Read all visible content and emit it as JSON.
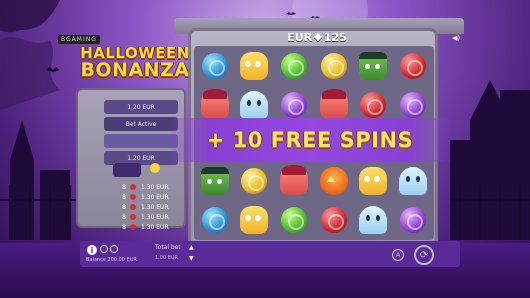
{
  "header": {
    "brand": "BGAMING",
    "balance_currency": "EUR",
    "balance_value": "125"
  },
  "game": {
    "title_line1": "HALLOWEEN",
    "title_line2": "BONANZA"
  },
  "side_panel": {
    "options": [
      "1.20 EUR",
      "Bet Active",
      "",
      "1.20 EUR"
    ],
    "paytable": [
      {
        "count": "8",
        "amount": "1.30 EUR"
      },
      {
        "count": "8",
        "amount": "1.30 EUR"
      },
      {
        "count": "8",
        "amount": "1.30 EUR"
      },
      {
        "count": "8",
        "amount": "1.30 EUR"
      },
      {
        "count": "8",
        "amount": "1.30 EUR"
      }
    ]
  },
  "reels": [
    [
      "blue",
      "mummy",
      "green",
      "yellow",
      "frank",
      "red"
    ],
    [
      "witch",
      "ghost",
      "purple",
      "witch",
      "red",
      "purple"
    ],
    [
      "",
      "",
      "",
      "",
      "",
      ""
    ],
    [
      "frank",
      "yellow",
      "witch",
      "pumpkin",
      "mummy",
      "ghost"
    ],
    [
      "blue",
      "mummy",
      "green",
      "red",
      "ghost",
      "purple"
    ]
  ],
  "banner": {
    "text": "+ 10 FREE SPINS"
  },
  "footer": {
    "info_icon": "i",
    "balance_label": "Balance 200.00 EUR",
    "total_bet_label": "Total bet",
    "total_bet_value": "1.00 EUR",
    "auto_label": "A",
    "spin_icon": "refresh-icon"
  }
}
